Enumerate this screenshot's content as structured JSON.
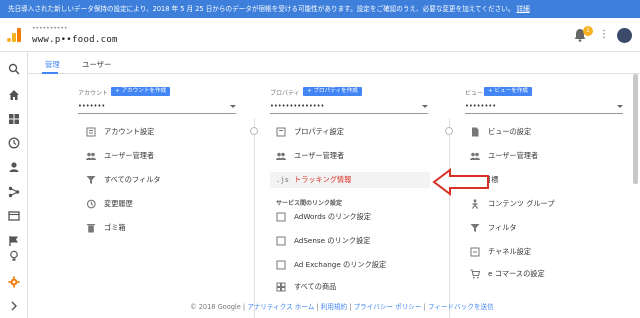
{
  "banner": {
    "text": "先日導入された新しいデータ保持の設定により、2018 年 5 月 25 日からのデータが宿帳を受ける可能性があります。設定をご確認のうえ、必要な変更を加えてください。",
    "link": "詳細"
  },
  "header": {
    "account_sub": "••••••••••",
    "account_url": "www.p••food.com",
    "notification_count": "1"
  },
  "tabs": [
    "管理",
    "ユーザー"
  ],
  "columns": {
    "account": {
      "label": "アカウント",
      "create_button": "+ アカウントを作成",
      "selected": "•••••••",
      "items": [
        "アカウント設定",
        "ユーザー管理者",
        "すべてのフィルタ",
        "変更履歴",
        "ゴミ箱"
      ]
    },
    "property": {
      "label": "プロパティ",
      "create_button": "+ プロパティを作成",
      "selected": "••••••••••••••",
      "items": [
        "プロパティ設定",
        "ユーザー管理者",
        "トラッキング情報"
      ],
      "tracking_prefix": ".js",
      "section_label": "サービス間のリンク設定",
      "link_items": [
        "AdWords のリンク設定",
        "AdSense のリンク設定",
        "Ad Exchange のリンク設定",
        "すべての商品"
      ]
    },
    "view": {
      "label": "ビュー",
      "create_button": "+ ビューを作成",
      "selected": "••••••••",
      "items": [
        "ビューの設定",
        "ユーザー管理者",
        "目標",
        "コンテンツ グループ",
        "フィルタ",
        "チャネル設定",
        "e コマースの設定"
      ]
    }
  },
  "footer": {
    "copyright": "© 2018 Google |",
    "links": [
      "アナリティクス ホーム",
      "利用規約",
      "プライバシー ポリシー",
      "フィードバックを送信"
    ],
    "separator": " | "
  },
  "colors": {
    "banner": "#3d7fdb",
    "accent": "#4285f4",
    "highlight_text": "#d93025",
    "admin_active": "#f57c00"
  }
}
